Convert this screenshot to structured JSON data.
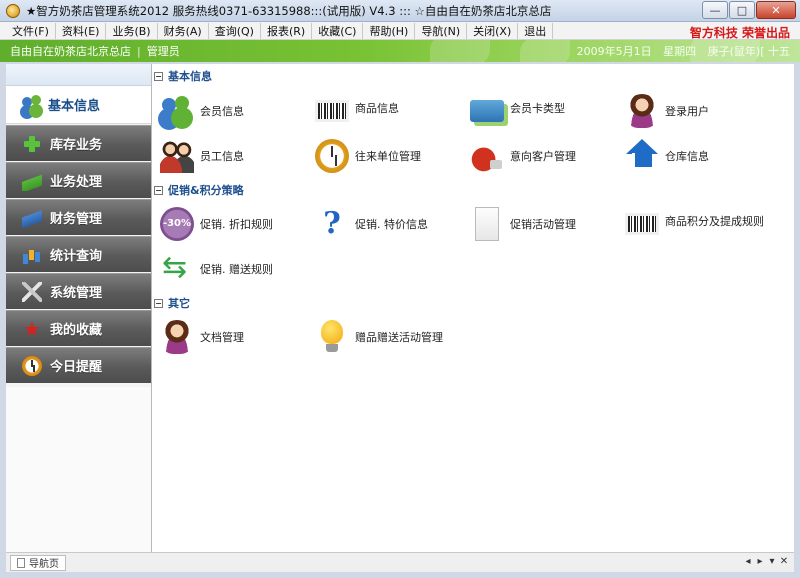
{
  "window": {
    "title": "★智方奶茶店管理系统2012 服务热线0371-63315988:::(试用版) V4.3 ::: ☆自由自在奶茶店北京总店",
    "minimize_glyph": "—",
    "maximize_glyph": "□",
    "close_glyph": "✕"
  },
  "menu": {
    "items": [
      "文件(F)",
      "资料(E)",
      "业务(B)",
      "财务(A)",
      "查询(Q)",
      "报表(R)",
      "收藏(C)",
      "帮助(H)",
      "导航(N)",
      "关闭(X)",
      "退出"
    ],
    "brand": "智方科技  荣誉出品"
  },
  "banner": {
    "store": "自由自在奶茶店北京总店",
    "separator": "|",
    "role": "管理员",
    "date": "2009年5月1日",
    "weekday": "星期四",
    "lunar": "庚子(鼠年)[ 十五"
  },
  "sidebar": {
    "active": "基本信息",
    "items": [
      "库存业务",
      "业务处理",
      "财务管理",
      "统计查询",
      "系统管理",
      "我的收藏",
      "今日提醒"
    ]
  },
  "sections": {
    "basic": {
      "title": "基本信息",
      "collapse": "−",
      "tiles": [
        "会员信息",
        "商品信息",
        "会员卡类型",
        "登录用户",
        "员工信息",
        "往来单位管理",
        "意向客户管理",
        "仓库信息"
      ]
    },
    "promo": {
      "title": "促销&积分策略",
      "collapse": "−",
      "tiles": [
        "促销. 折扣规则",
        "促销. 特价信息",
        "促销活动管理",
        "商品积分及提成规则",
        "促销. 赠送规则"
      ]
    },
    "other": {
      "title": "其它",
      "collapse": "−",
      "tiles": [
        "文档管理",
        "赠品赠送活动管理"
      ]
    }
  },
  "icons": {
    "discount_text": "-30%",
    "question_mark": "?",
    "star": "★"
  },
  "bottombar": {
    "tab": "导航页",
    "prev": "◂",
    "next": "▸",
    "menu": "▾",
    "close": "✕"
  },
  "colors": {
    "brand_red": "#d71818",
    "banner_green": "#79c234",
    "section_blue": "#1e4f8f",
    "sidebar_dark": "#5a5a5a"
  }
}
